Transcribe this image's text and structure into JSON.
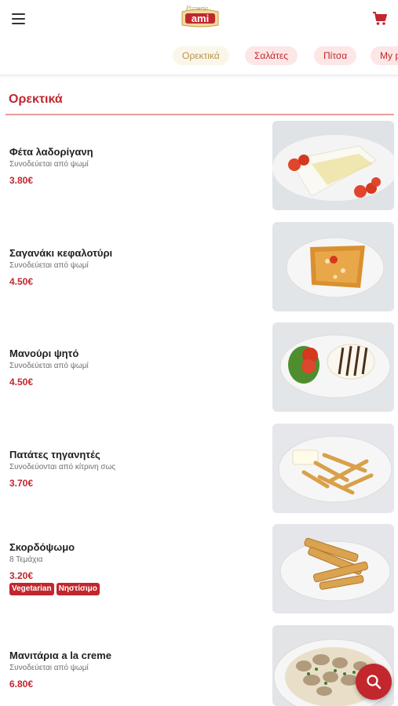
{
  "header": {
    "menu_icon": "hamburger-menu-icon",
    "logo_text": "ami",
    "logo_script": "Pizzeria",
    "cart_icon": "shopping-cart-icon"
  },
  "tabs": [
    {
      "label": "Ορεκτικά",
      "active": true
    },
    {
      "label": "Σαλάτες",
      "active": false
    },
    {
      "label": "Πίτσα",
      "active": false
    },
    {
      "label": "My p",
      "active": false
    }
  ],
  "section": {
    "title": "Ορεκτικά"
  },
  "items": [
    {
      "name": "Φέτα λαδορίγανη",
      "desc": "Συνοδεύεται από ψωμί",
      "price": "3.80€",
      "image": "feta-photo"
    },
    {
      "name": "Σαγανάκι κεφαλοτύρι",
      "desc": "Συνοδεύεται από ψωμί",
      "price": "4.50€",
      "image": "saganaki-photo"
    },
    {
      "name": "Μανούρι ψητό",
      "desc": "Συνοδεύεται από ψωμί",
      "price": "4.50€",
      "image": "manouri-photo"
    },
    {
      "name": "Πατάτες τηγανητές",
      "desc": "Συνοδεύονται από κίτρινη σως",
      "price": "3.70€",
      "image": "fries-photo"
    },
    {
      "name": "Σκορδόψωμο",
      "desc": "8 Τεμάχια",
      "price": "3.20€",
      "tags": [
        "Vegetarian",
        "Νηστίσιμο"
      ],
      "image": "garlic-bread-photo"
    },
    {
      "name": "Μανιτάρια a la creme",
      "desc": "Συνοδεύεται από ψωμί",
      "price": "6.80€",
      "image": "mushrooms-photo"
    }
  ],
  "fab": {
    "icon": "search-icon"
  },
  "colors": {
    "accent": "#c1272d",
    "gold": "#b9934b",
    "tab_bg": "#fde7e6"
  }
}
